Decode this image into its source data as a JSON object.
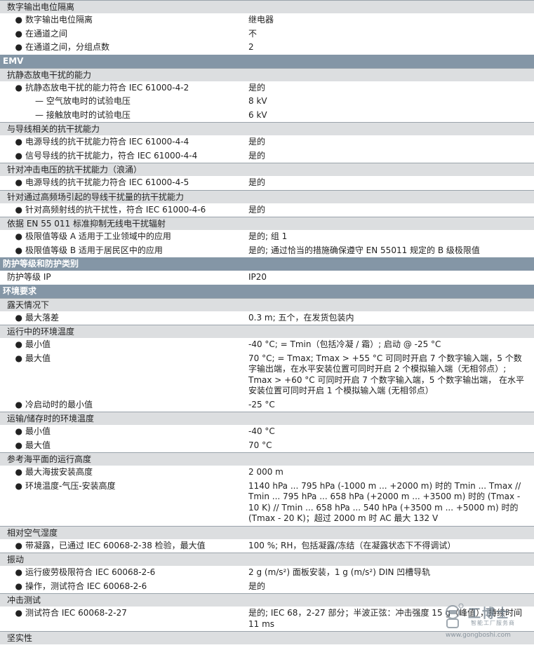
{
  "sections": [
    {
      "kind": "group",
      "text": "数字输出电位隔离"
    },
    {
      "kind": "item",
      "style": "bullet",
      "label": "数字输出电位隔离",
      "value": "继电器"
    },
    {
      "kind": "item",
      "style": "bullet",
      "label": "在通道之间",
      "value": "不"
    },
    {
      "kind": "item",
      "style": "bullet",
      "label": "在通道之间，分组点数",
      "value": "2"
    },
    {
      "kind": "cat",
      "text": "EMV"
    },
    {
      "kind": "group",
      "text": "抗静态放电干扰的能力"
    },
    {
      "kind": "item",
      "style": "bullet",
      "label": "抗静态放电干扰的能力符合 IEC 61000-4-2",
      "value": "是的"
    },
    {
      "kind": "item",
      "style": "sub",
      "label": "— 空气放电时的试验电压",
      "value": "8 kV"
    },
    {
      "kind": "item",
      "style": "sub",
      "label": "— 接触放电时的试验电压",
      "value": "6 kV"
    },
    {
      "kind": "group",
      "text": "与导线相关的抗干扰能力"
    },
    {
      "kind": "item",
      "style": "bullet",
      "label": "电源导线的抗干扰能力符合 IEC 61000-4-4",
      "value": "是的"
    },
    {
      "kind": "item",
      "style": "bullet",
      "label": "信号导线的抗干扰能力，符合 IEC 61000-4-4",
      "value": "是的"
    },
    {
      "kind": "group",
      "text": "针对冲击电压的抗干扰能力（浪涌）"
    },
    {
      "kind": "item",
      "style": "bullet",
      "label": "电源导线的抗干扰能力符合 IEC 61000-4-5",
      "value": "是的"
    },
    {
      "kind": "group",
      "text": "针对通过高频场引起的导线干扰量的抗干扰能力"
    },
    {
      "kind": "item",
      "style": "bullet",
      "label": "针对高频射线的抗干扰性，符合 IEC 61000-4-6",
      "value": "是的"
    },
    {
      "kind": "group",
      "text": "依据 EN 55 011 标准抑制无线电干扰辐射"
    },
    {
      "kind": "item",
      "style": "bullet",
      "label": "极限值等级 A 适用于工业领域中的应用",
      "value": "是的; 组 1"
    },
    {
      "kind": "item",
      "style": "bullet",
      "label": "极限值等级 B 适用于居民区中的应用",
      "value": "是的; 通过恰当的措施确保遵守 EN 55011 规定的 B 级极限值"
    },
    {
      "kind": "cat",
      "text": "防护等级和防护类别"
    },
    {
      "kind": "item",
      "style": "plain",
      "label": "防护等级 IP",
      "value": "IP20"
    },
    {
      "kind": "cat",
      "text": "环境要求"
    },
    {
      "kind": "group",
      "text": "露天情况下"
    },
    {
      "kind": "item",
      "style": "bullet",
      "label": "最大落差",
      "value": "0.3 m; 五个，在发货包装内"
    },
    {
      "kind": "group",
      "text": "运行中的环境温度"
    },
    {
      "kind": "item",
      "style": "bullet",
      "label": "最小值",
      "value": "-40 °C; = Tmin（包括冷凝 / 霜）; 启动 @ -25 °C"
    },
    {
      "kind": "item",
      "style": "bullet",
      "label": "最大值",
      "value": "70 °C; = Tmax; Tmax > +55 °C 可同时开启 7 个数字输入端，5 个数字输出端，在水平安装位置可同时开启 2 个模拟输入端（无相邻点）; Tmax > +60 °C 可同时开启 7 个数字输入端，5 个数字输出端， 在水平安装位置可同时开启 1 个模拟输入端 (无相邻点）"
    },
    {
      "kind": "item",
      "style": "bullet",
      "label": "冷启动时的最小值",
      "value": "-25 °C"
    },
    {
      "kind": "group",
      "text": "运输/储存时的环境温度"
    },
    {
      "kind": "item",
      "style": "bullet",
      "label": "最小值",
      "value": "-40 °C"
    },
    {
      "kind": "item",
      "style": "bullet",
      "label": "最大值",
      "value": "70 °C"
    },
    {
      "kind": "group",
      "text": "参考海平面的运行高度"
    },
    {
      "kind": "item",
      "style": "bullet",
      "label": "最大海拔安装高度",
      "value": "2 000 m"
    },
    {
      "kind": "item",
      "style": "bullet",
      "label": "环境温度-气压-安装高度",
      "value": "1140 hPa ... 795 hPa (-1000 m ... +2000 m) 时的 Tmin ... Tmax // Tmin ... 795 hPa ... 658 hPa (+2000 m ... +3500 m) 时的 (Tmax - 10 K) // Tmin ... 658 hPa ... 540 hPa (+3500 m ... +5000 m) 时的 (Tmax - 20 K)；超过 2000 m 时 AC 最大 132 V"
    },
    {
      "kind": "group",
      "text": "相对空气湿度"
    },
    {
      "kind": "item",
      "style": "bullet",
      "label": "带凝露，已通过 IEC 60068-2-38 检验，最大值",
      "value": "100 %; RH，包括凝露/冻结（在凝露状态下不得调试）"
    },
    {
      "kind": "group",
      "text": "振动"
    },
    {
      "kind": "item",
      "style": "bullet",
      "label": "运行疲劳极限符合 IEC 60068-2-6",
      "value": "2 g (m/s²) 面板安装，1 g (m/s²) DIN 凹槽导轨"
    },
    {
      "kind": "item",
      "style": "bullet",
      "label": "操作，测试符合 IEC 60068-2-6",
      "value": "是的"
    },
    {
      "kind": "group",
      "text": "冲击测试"
    },
    {
      "kind": "item",
      "style": "bullet",
      "label": "测试符合 IEC 60068-2-27",
      "value": "是的; IEC 68，2-27 部分；半波正弦：冲击强度 15 g（峰值），持续时间 11 ms"
    },
    {
      "kind": "group",
      "text": "坚实性"
    }
  ],
  "watermark": {
    "brand": "工博士",
    "slogan": "智能工厂服务商",
    "url": "www.gongboshi.com",
    "color": "#6c7a86"
  }
}
